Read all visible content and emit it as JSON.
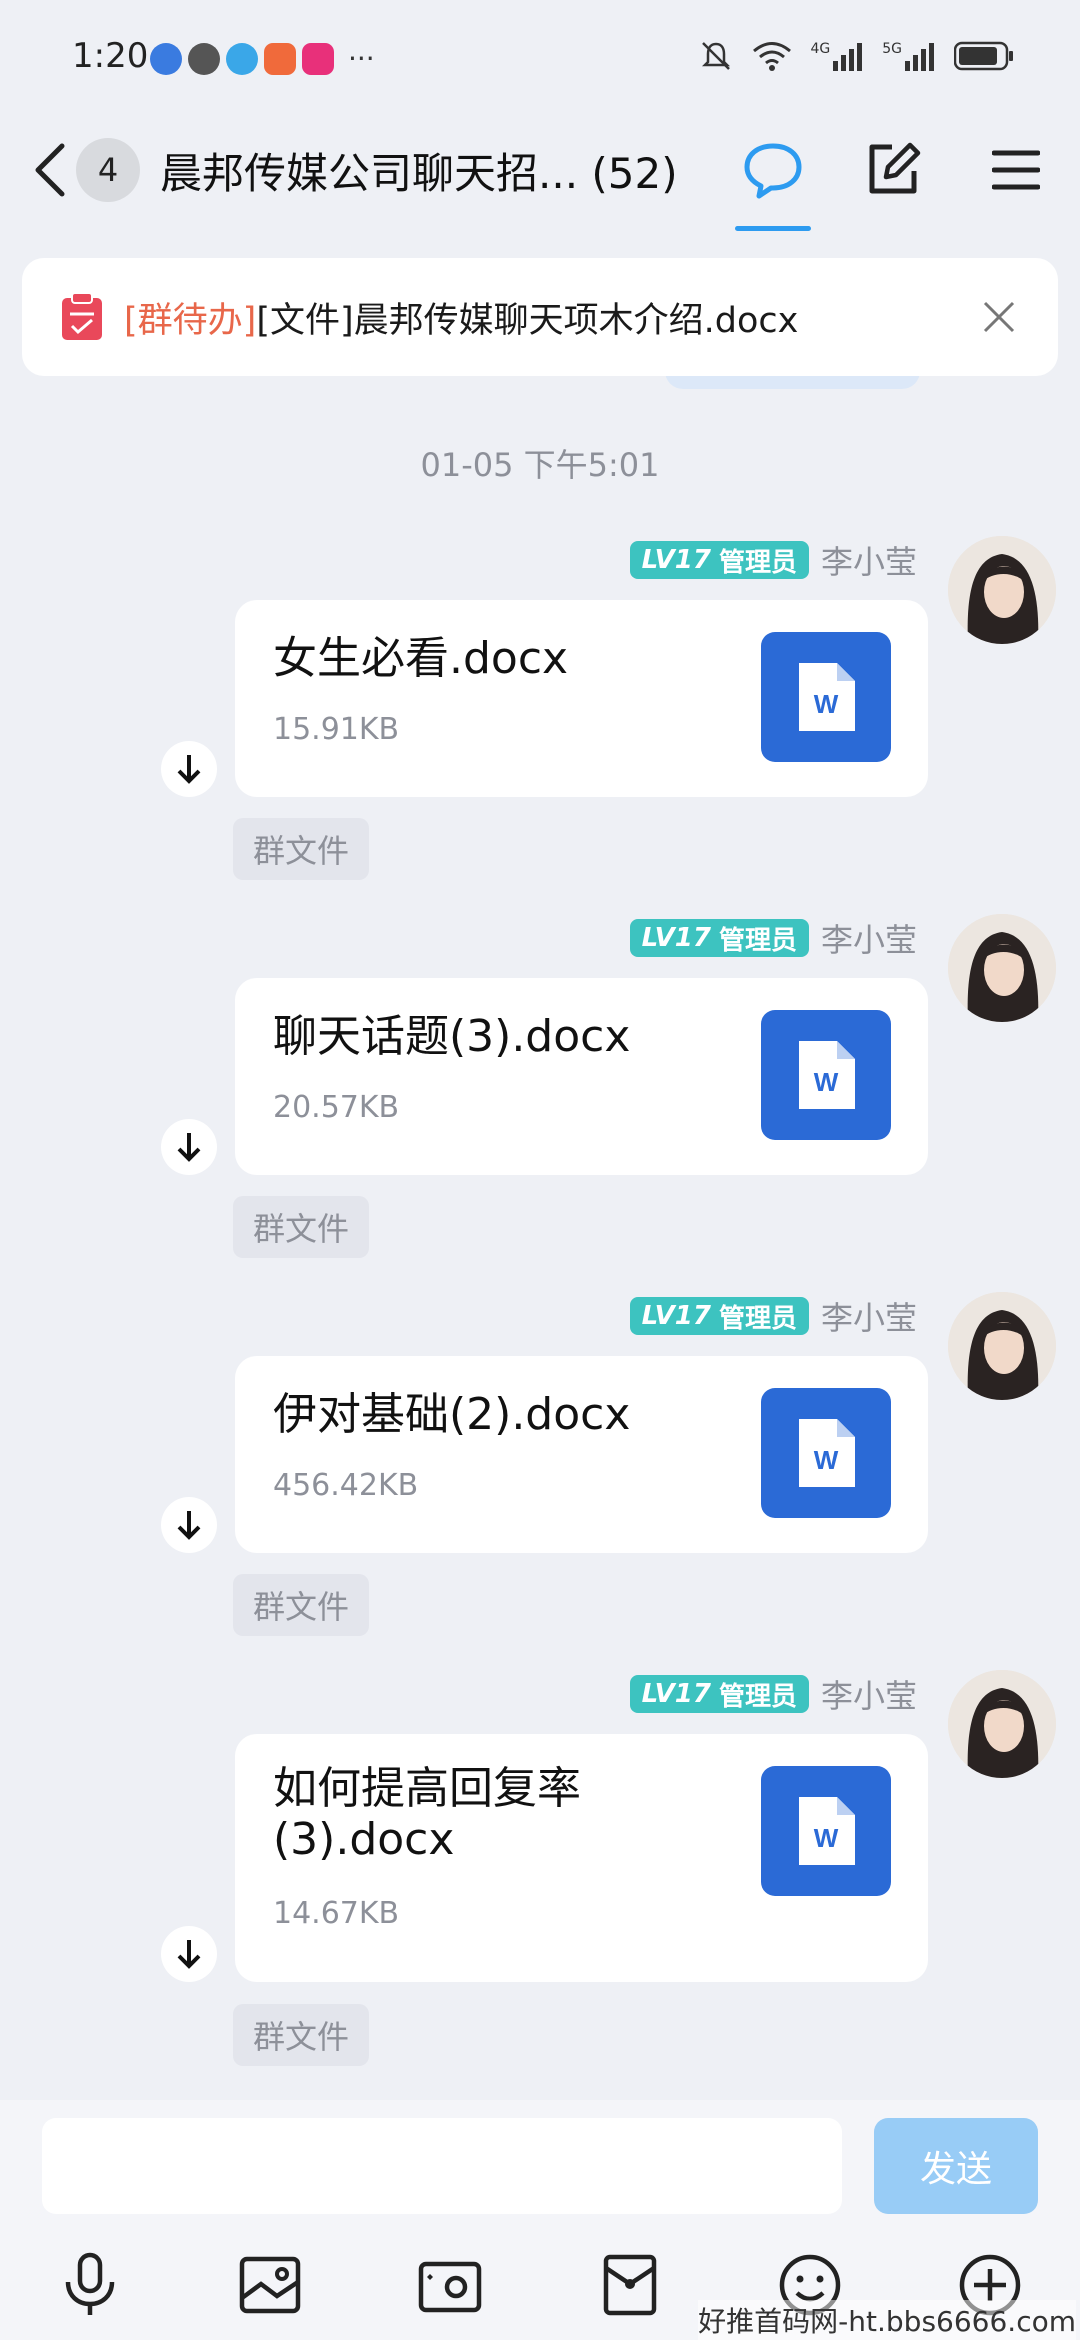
{
  "status_bar": {
    "time": "1:20",
    "apps": [
      "browser-app",
      "wechat-app",
      "chat-app",
      "shop-app",
      "promo-app"
    ],
    "more": "···",
    "net1": "4G",
    "net2": "5G"
  },
  "header": {
    "back_count": "4",
    "title": "晨邦传媒公司聊天招... (52)"
  },
  "notice": {
    "tag": "[群待办]",
    "text": "[文件]晨邦传媒聊天项木介绍.docx"
  },
  "timestamp": "01-05 下午5:01",
  "messages": [
    {
      "level": "LV17",
      "role": "管理员",
      "sender": "李小莹",
      "file_name": "女生必看.docx",
      "file_size": "15.91KB",
      "tag": "群文件"
    },
    {
      "level": "LV17",
      "role": "管理员",
      "sender": "李小莹",
      "file_name": "聊天话题(3).docx",
      "file_size": "20.57KB",
      "tag": "群文件"
    },
    {
      "level": "LV17",
      "role": "管理员",
      "sender": "李小莹",
      "file_name": "伊对基础(2).docx",
      "file_size": "456.42KB",
      "tag": "群文件"
    },
    {
      "level": "LV17",
      "role": "管理员",
      "sender": "李小莹",
      "file_name": "如何提高回复率(3).docx",
      "file_name_line1": "如何提高回复率",
      "file_name_line2": "(3).docx",
      "file_size": "14.67KB",
      "tag": "群文件"
    }
  ],
  "input": {
    "send_label": "发送"
  },
  "watermark": "好推首码网-ht.bbs6666.com",
  "colors": {
    "accent": "#2d9bf0",
    "doc_blue": "#2b6ad6",
    "level_badge": "#3dc3c0",
    "todo_tag": "#e8674a",
    "send_disabled": "#98ccf6"
  }
}
